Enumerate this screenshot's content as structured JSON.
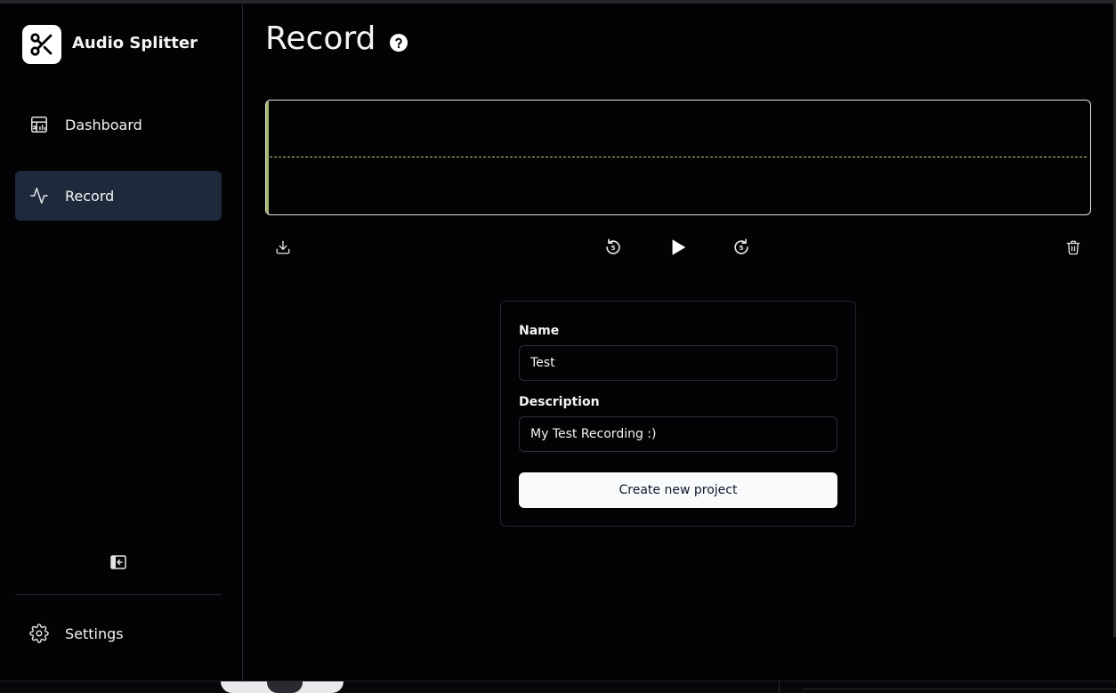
{
  "app": {
    "title": "Audio Splitter",
    "logo_icon": "scissors-icon"
  },
  "sidebar": {
    "items": [
      {
        "label": "Dashboard",
        "icon": "dashboard-icon",
        "active": false
      },
      {
        "label": "Record",
        "icon": "activity-icon",
        "active": true
      }
    ],
    "collapse_icon": "sidebar-collapse-icon",
    "settings": {
      "label": "Settings",
      "icon": "gear-icon"
    }
  },
  "page": {
    "title": "Record",
    "help_icon": "help-circle-icon"
  },
  "player": {
    "controls": [
      {
        "name": "download",
        "icon": "download-icon"
      },
      {
        "name": "rewind-5",
        "icon": "rotate-ccw-5-icon",
        "text": "5"
      },
      {
        "name": "play",
        "icon": "play-icon"
      },
      {
        "name": "forward-5",
        "icon": "rotate-cw-5-icon",
        "text": "5"
      },
      {
        "name": "delete",
        "icon": "trash-icon"
      }
    ]
  },
  "form": {
    "name_label": "Name",
    "name_value": "Test",
    "description_label": "Description",
    "description_value": "My Test Recording :)",
    "submit_label": "Create new project"
  },
  "colors": {
    "background": "#030306",
    "active_nav": "#1e293b",
    "waveform_cursor": "#a3b86c",
    "waveform_line": "#b4d27a",
    "button_bg": "#f8fafc"
  }
}
